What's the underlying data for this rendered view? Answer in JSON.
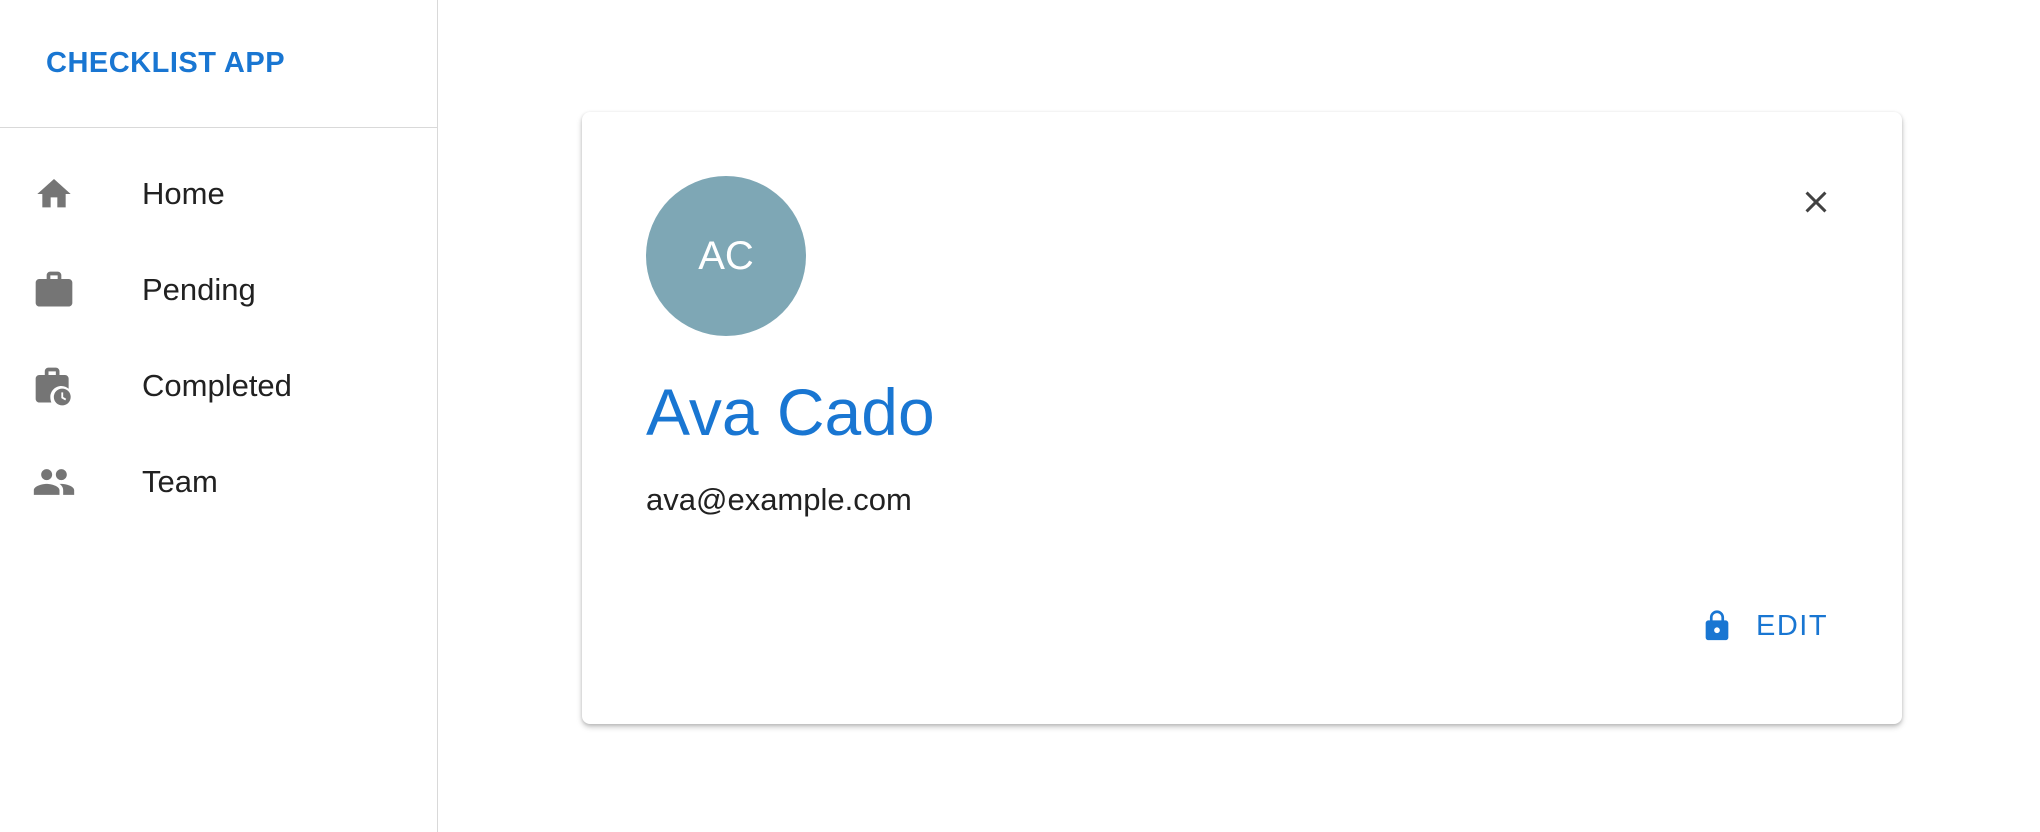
{
  "app": {
    "title": "CHECKLIST APP"
  },
  "sidebar": {
    "items": [
      {
        "label": "Home",
        "icon": "home-icon"
      },
      {
        "label": "Pending",
        "icon": "briefcase-icon"
      },
      {
        "label": "Completed",
        "icon": "briefcase-clock-icon"
      },
      {
        "label": "Team",
        "icon": "people-icon"
      }
    ]
  },
  "profile": {
    "initials": "AC",
    "name": "Ava Cado",
    "email": "ava@example.com",
    "edit_label": "EDIT"
  },
  "colors": {
    "accent": "#1976d2",
    "avatar_bg": "#7ea7b5",
    "icon_gray": "#757575"
  }
}
